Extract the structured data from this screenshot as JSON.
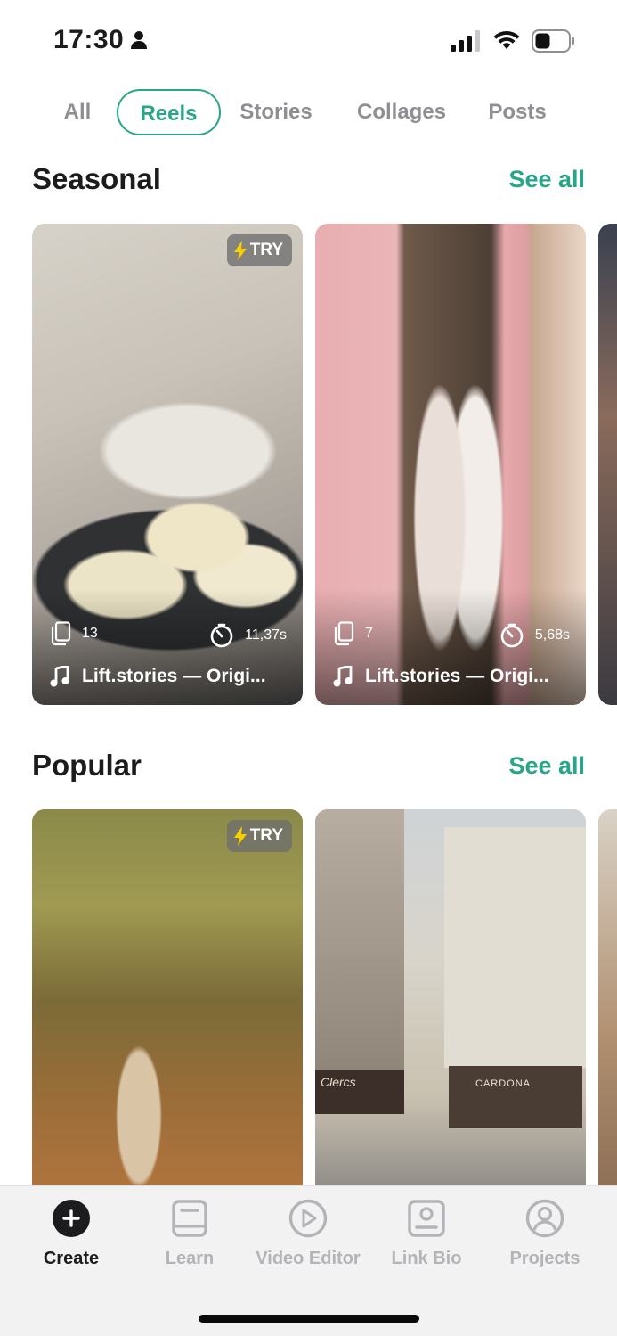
{
  "status_bar": {
    "time": "17:30"
  },
  "tabs": [
    {
      "label": "All",
      "active": false
    },
    {
      "label": "Reels",
      "active": true
    },
    {
      "label": "Stories",
      "active": false
    },
    {
      "label": "Collages",
      "active": false
    },
    {
      "label": "Posts",
      "active": false
    }
  ],
  "accent": "#2aa588",
  "seasonal": {
    "title": "Seasonal",
    "see_all": "See all",
    "cards": [
      {
        "try": "TRY",
        "slides": "13",
        "duration": "11,37s",
        "audio": "Lift.stories — Origi..."
      },
      {
        "try": "",
        "slides": "7",
        "duration": "5,68s",
        "audio": "Lift.stories — Origi..."
      }
    ]
  },
  "popular": {
    "title": "Popular",
    "see_all": "See all",
    "cards": [
      {
        "try": "TRY"
      },
      {
        "storefront_text": "CARDONA",
        "sign_text": "Clercs"
      }
    ]
  },
  "tabbar": [
    {
      "label": "Create",
      "icon": "plus-circle-icon",
      "active": true
    },
    {
      "label": "Learn",
      "icon": "book-icon",
      "active": false
    },
    {
      "label": "Video Editor",
      "icon": "play-circle-icon",
      "active": false
    },
    {
      "label": "Link Bio",
      "icon": "profile-card-icon",
      "active": false
    },
    {
      "label": "Projects",
      "icon": "user-circle-icon",
      "active": false
    }
  ]
}
